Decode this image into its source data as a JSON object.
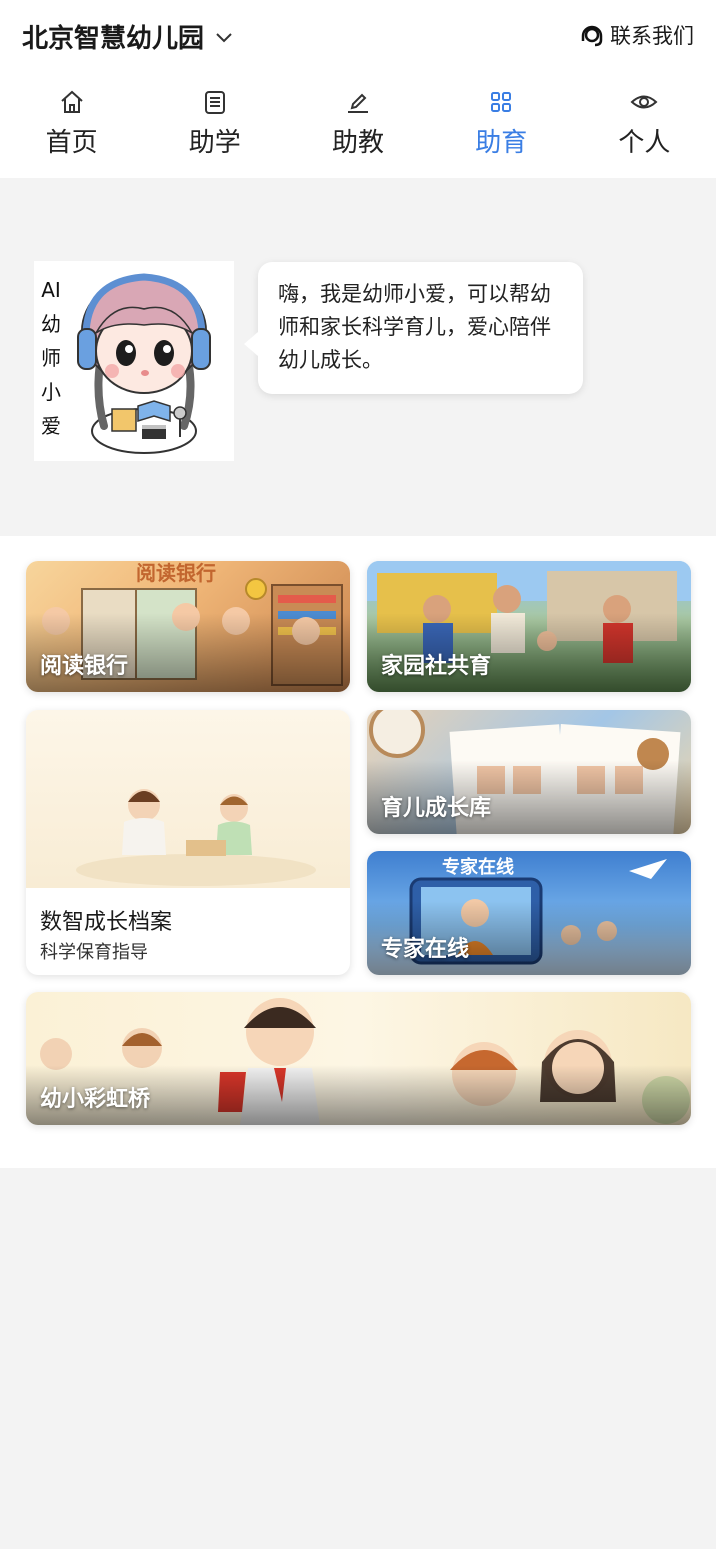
{
  "header": {
    "school_name": "北京智慧幼儿园",
    "contact_label": "联系我们"
  },
  "tabs": [
    {
      "label": "首页",
      "icon": "home-icon"
    },
    {
      "label": "助学",
      "icon": "notebook-icon"
    },
    {
      "label": "助教",
      "icon": "pencil-icon"
    },
    {
      "label": "助育",
      "icon": "grid-icon",
      "active": true
    },
    {
      "label": "个人",
      "icon": "eye-icon"
    }
  ],
  "assistant": {
    "name_chars": [
      "AI",
      "幼",
      "师",
      "小",
      "爱"
    ],
    "greeting": "嗨，我是幼师小爱，可以帮幼师和家长科学育儿，爱心陪伴幼儿成长。"
  },
  "cards": {
    "reading_bank": {
      "title": "阅读银行",
      "banner": "阅读银行"
    },
    "home_school": {
      "title": "家园社共育"
    },
    "growth_archive": {
      "title": "数智成长档案",
      "subtitle": "科学保育指导"
    },
    "parenting_library": {
      "title": "育儿成长库"
    },
    "expert_online": {
      "title": "专家在线",
      "banner": "专家在线"
    },
    "rainbow_bridge": {
      "title": "幼小彩虹桥"
    }
  },
  "colors": {
    "active_tab": "#3a7ee4",
    "page_bg": "#f3f3f3"
  }
}
